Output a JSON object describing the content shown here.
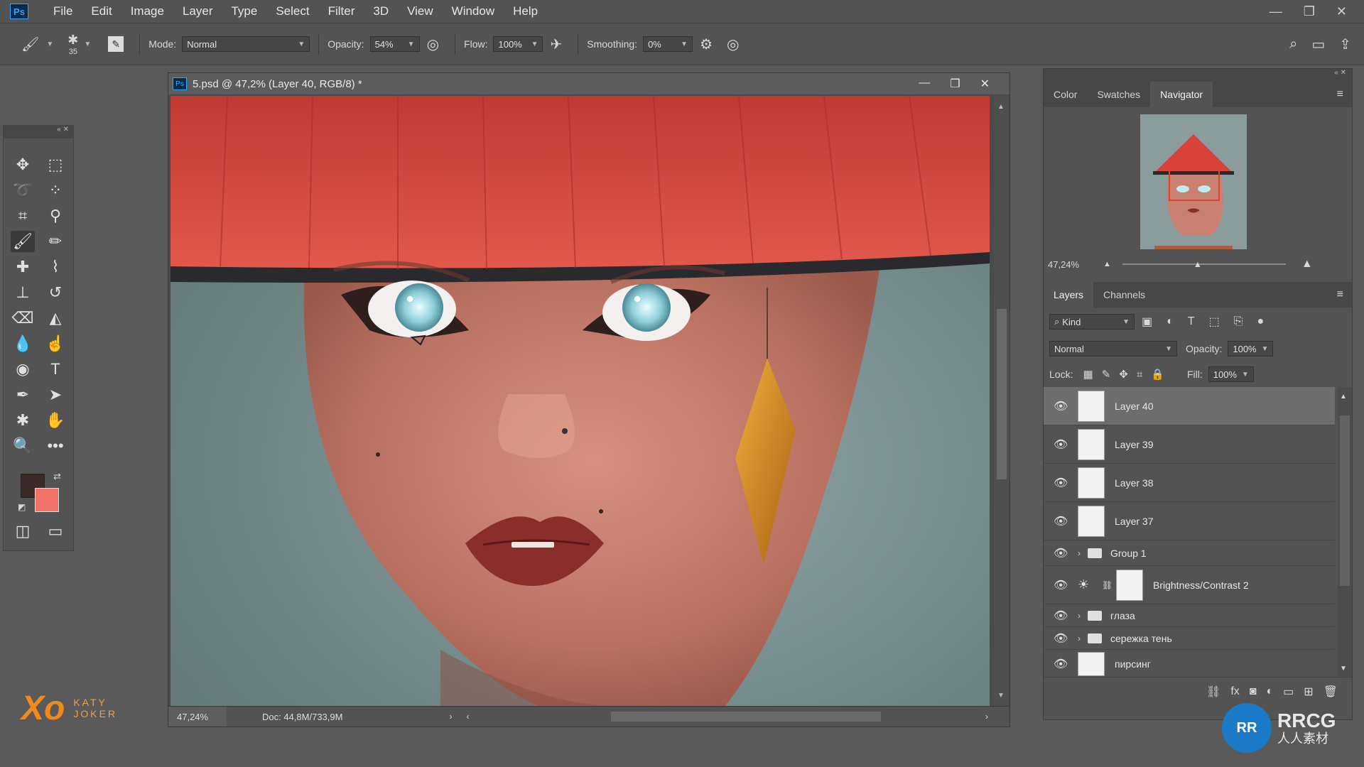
{
  "menubar": {
    "app_logo": "Ps",
    "items": [
      "File",
      "Edit",
      "Image",
      "Layer",
      "Type",
      "Select",
      "Filter",
      "3D",
      "View",
      "Window",
      "Help"
    ],
    "window_controls": [
      "—",
      "❐",
      "✕"
    ]
  },
  "options": {
    "brush_size": "35",
    "mode_label": "Mode:",
    "mode_value": "Normal",
    "opacity_label": "Opacity:",
    "opacity_value": "54%",
    "flow_label": "Flow:",
    "flow_value": "100%",
    "smoothing_label": "Smoothing:",
    "smoothing_value": "0%"
  },
  "document": {
    "title": "5.psd @ 47,2% (Layer 40, RGB/8) *",
    "zoom": "47,24%",
    "doc_info": "Doc: 44,8M/733,9M",
    "controls": [
      "—",
      "❐",
      "✕"
    ]
  },
  "top_panel": {
    "tabs": [
      "Color",
      "Swatches",
      "Navigator"
    ],
    "active_tab": "Navigator",
    "nav_zoom": "47,24%"
  },
  "layers_panel": {
    "tabs": [
      "Layers",
      "Channels"
    ],
    "kind_label": "Kind",
    "blend_mode": "Normal",
    "opacity_label": "Opacity:",
    "opacity_value": "100%",
    "lock_label": "Lock:",
    "fill_label": "Fill:",
    "fill_value": "100%",
    "layers": [
      {
        "name": "Layer 40",
        "type": "layer",
        "selected": true
      },
      {
        "name": "Layer 39",
        "type": "layer"
      },
      {
        "name": "Layer 38",
        "type": "layer"
      },
      {
        "name": "Layer 37",
        "type": "layer"
      },
      {
        "name": "Group 1",
        "type": "group"
      },
      {
        "name": "Brightness/Contrast 2",
        "type": "adjustment"
      },
      {
        "name": "глаза",
        "type": "group"
      },
      {
        "name": "сережка тень",
        "type": "group"
      },
      {
        "name": "пирсинг",
        "type": "layer"
      }
    ]
  },
  "branding": {
    "logo_text": "KATY JOKER",
    "watermark": "RRCG",
    "watermark_sub": "人人素材"
  },
  "colors": {
    "foreground": "#3a2a28",
    "background": "#f0726a",
    "accent": "#31a8ff",
    "hat_red": "#d8433c"
  }
}
